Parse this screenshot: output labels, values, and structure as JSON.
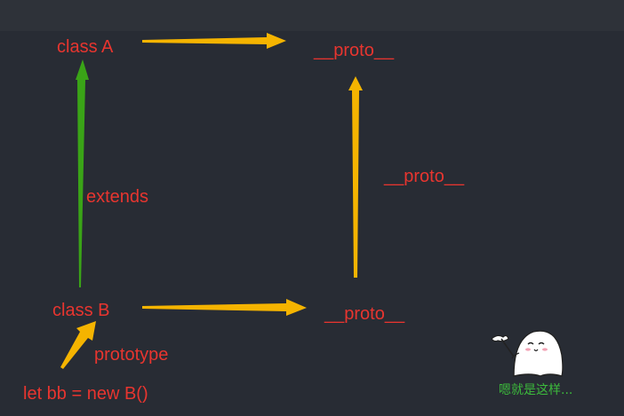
{
  "diagram": {
    "nodes": {
      "class_a": "class A",
      "class_b": "class B",
      "instance": "let bb = new B()",
      "proto_top": "__proto__",
      "proto_bottom": "__proto__"
    },
    "edge_labels": {
      "extends": "extends",
      "proto_vertical": "__proto__",
      "prototype": "prototype"
    },
    "caption": "嗯就是这样..."
  },
  "colors": {
    "background": "#282c34",
    "topbar": "#2e3239",
    "label": "#e8352f",
    "arrow_yellow": "#f5b400",
    "arrow_green": "#3aa417",
    "caption": "#3cba3c"
  },
  "icons": {
    "mascot": "ghost-waving-flag-icon"
  }
}
